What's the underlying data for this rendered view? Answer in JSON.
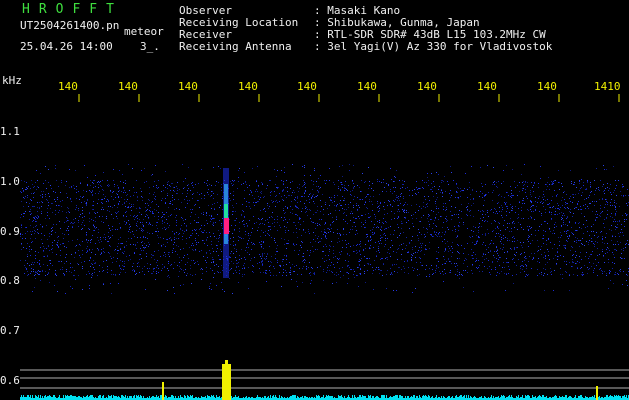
{
  "header": {
    "app_title": "HROFFT",
    "file_name": "UT2504261400.pn",
    "mode": "meteor",
    "datetime": "25.04.26 14:00",
    "count": "3_."
  },
  "info": [
    {
      "label": "Observer",
      "sep": ":",
      "value": "Masaki Kano"
    },
    {
      "label": "Receiving Location",
      "sep": ":",
      "value": "Shibukawa, Gunma, Japan"
    },
    {
      "label": "Receiver",
      "sep": ":",
      "value": "RTL-SDR SDR# 43dB L15 103.2MHz CW"
    },
    {
      "label": "Receiving Antenna",
      "sep": ":",
      "value": "3el Yagi(V) Az 330 for Vladivostok"
    }
  ],
  "axis": {
    "y_unit": "kHz",
    "y_ticks": [
      "1.1",
      "1.0",
      "0.9",
      "0.8",
      "0.7",
      "0.6"
    ],
    "x_ticks": [
      "140",
      "140",
      "140",
      "140",
      "140",
      "140",
      "140",
      "140",
      "140",
      "1410"
    ]
  },
  "colors": {
    "background": "#000000",
    "label_green": "#3fdf3f",
    "tick_yellow": "#f0f000",
    "noise_blue": "#1a2bd8",
    "signal_magenta": "#ff2080",
    "signal_green": "#20e0a0",
    "baseline_cyan": "#00e0f0",
    "spike_yellow": "#f0f000"
  }
}
